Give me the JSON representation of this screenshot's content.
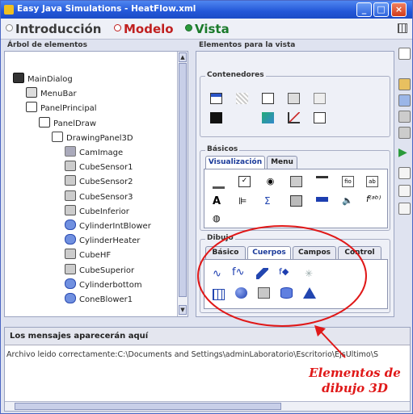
{
  "window": {
    "title": "Easy Java Simulations - HeatFlow.xml"
  },
  "modes": [
    {
      "label": "Introducción",
      "state": "off"
    },
    {
      "label": "Modelo",
      "state": "off-red"
    },
    {
      "label": "Vista",
      "state": "on"
    }
  ],
  "left": {
    "title": "Árbol de elementos",
    "tree": [
      {
        "label": "MainDialog",
        "icon": "dialog-icon",
        "depth": 0
      },
      {
        "label": "MenuBar",
        "icon": "menubar-icon",
        "depth": 1
      },
      {
        "label": "PanelPrincipal",
        "icon": "panel-icon",
        "depth": 1
      },
      {
        "label": "PanelDraw",
        "icon": "panel-icon",
        "depth": 2
      },
      {
        "label": "DrawingPanel3D",
        "icon": "drawing-panel-3d-icon",
        "depth": 3
      },
      {
        "label": "CamImage",
        "icon": "camera-icon",
        "depth": 4
      },
      {
        "label": "CubeSensor1",
        "icon": "cube-icon",
        "depth": 4
      },
      {
        "label": "CubeSensor2",
        "icon": "cube-icon",
        "depth": 4
      },
      {
        "label": "CubeSensor3",
        "icon": "cube-icon",
        "depth": 4
      },
      {
        "label": "CubeInferior",
        "icon": "cube-icon",
        "depth": 4
      },
      {
        "label": "CylinderIntBlower",
        "icon": "cylinder-icon",
        "depth": 4
      },
      {
        "label": "CylinderHeater",
        "icon": "cylinder-icon",
        "depth": 4
      },
      {
        "label": "CubeHF",
        "icon": "cube-icon",
        "depth": 4
      },
      {
        "label": "CubeSuperior",
        "icon": "cube-icon",
        "depth": 4
      },
      {
        "label": "Cylinderbottom",
        "icon": "cylinder-icon",
        "depth": 4
      },
      {
        "label": "ConeBlower1",
        "icon": "cone-icon",
        "depth": 4
      }
    ]
  },
  "right": {
    "title": "Elementos para la vista",
    "contenedores": {
      "title": "Contenedores"
    },
    "basicos": {
      "title": "Básicos",
      "tabs": [
        "Visualización",
        "Menu"
      ]
    },
    "dibujo": {
      "title": "Dibujo",
      "tabs": [
        "Básico",
        "Cuerpos",
        "Campos",
        "Control"
      ]
    }
  },
  "messages": {
    "header": "Los mensajes aparecerán aquí",
    "text": "Archivo leido correctamente:C:\\Documents and Settings\\adminLaboratorio\\Escritorio\\EjsUltimo\\S"
  },
  "annotation": {
    "line1": "Elementos de",
    "line2": "dibujo  3D",
    "color": "#e01818"
  }
}
